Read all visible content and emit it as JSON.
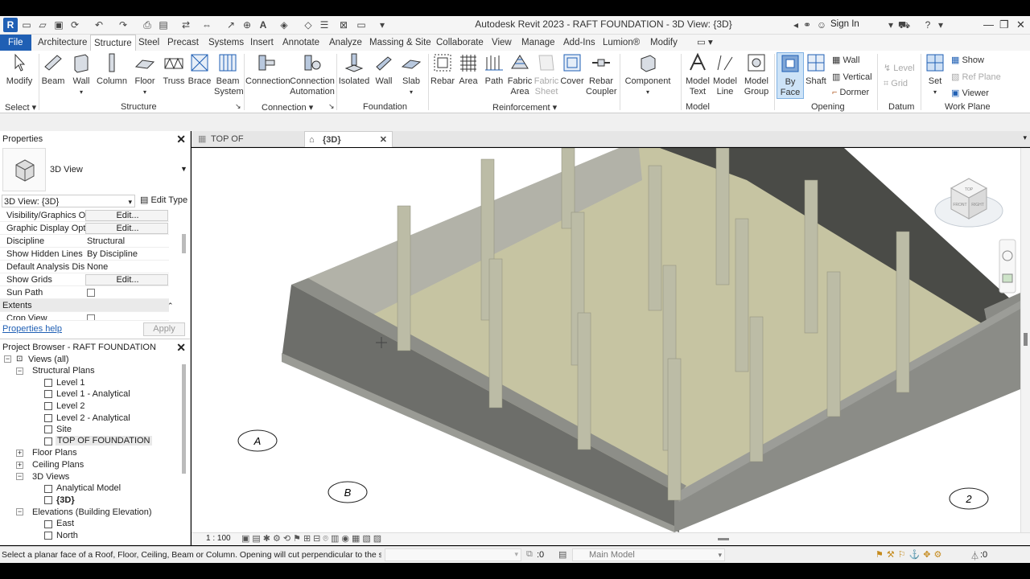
{
  "window": {
    "title": "Autodesk Revit 2023 - RAFT FOUNDATION - 3D View: {3D}",
    "sign_in": "Sign In",
    "app_letter": "R"
  },
  "ribbon_tabs": [
    "File",
    "Architecture",
    "Structure",
    "Steel",
    "Precast",
    "Systems",
    "Insert",
    "Annotate",
    "Analyze",
    "Massing & Site",
    "Collaborate",
    "View",
    "Manage",
    "Add-Ins",
    "Lumion®",
    "Modify"
  ],
  "active_tab": "Structure",
  "ribbon": {
    "tools": [
      {
        "label": "Modify"
      },
      {
        "label": "Beam"
      },
      {
        "label": "Wall"
      },
      {
        "label": "Column"
      },
      {
        "label": "Floor"
      },
      {
        "label": "Truss"
      },
      {
        "label": "Brace"
      },
      {
        "label": "Beam\nSystem"
      },
      {
        "label": "Connection"
      },
      {
        "label": "Connection\nAutomation"
      },
      {
        "label": "Isolated"
      },
      {
        "label": "Wall"
      },
      {
        "label": "Slab"
      },
      {
        "label": "Rebar"
      },
      {
        "label": "Area"
      },
      {
        "label": "Path"
      },
      {
        "label": "Fabric\nArea"
      },
      {
        "label": "Fabric\nSheet"
      },
      {
        "label": "Cover"
      },
      {
        "label": "Rebar\nCoupler"
      },
      {
        "label": "Component"
      },
      {
        "label": "Model\nText"
      },
      {
        "label": "Model\nLine"
      },
      {
        "label": "Model\nGroup"
      },
      {
        "label": "By\nFace"
      },
      {
        "label": "Shaft"
      }
    ],
    "opening_small": [
      "Wall",
      "Vertical",
      "Dormer"
    ],
    "datum_small": [
      "Level",
      "Grid"
    ],
    "workplane_set": "Set",
    "workplane_small": [
      "Show",
      "Ref  Plane",
      "Viewer"
    ],
    "panels": [
      "Select",
      "Structure",
      "Connection",
      "Foundation",
      "Reinforcement",
      "Model",
      "Opening",
      "Datum",
      "Work Plane"
    ]
  },
  "properties": {
    "title": "Properties",
    "type_name": "3D View",
    "selector": "3D View: {3D}",
    "edit_type": "Edit Type",
    "rows": [
      {
        "key": "Visibility/Graphics O...",
        "value": "Edit..."
      },
      {
        "key": "Graphic Display Opt...",
        "value": "Edit..."
      },
      {
        "key": "Discipline",
        "value": "Structural"
      },
      {
        "key": "Show Hidden Lines",
        "value": "By Discipline"
      },
      {
        "key": "Default Analysis Dis...",
        "value": "None"
      },
      {
        "key": "Show Grids",
        "value": "Edit..."
      },
      {
        "key": "Sun Path",
        "value": ""
      }
    ],
    "section": "Extents",
    "crop_view": "Crop View",
    "help": "Properties help",
    "apply": "Apply"
  },
  "browser": {
    "title": "Project Browser - RAFT FOUNDATION",
    "items": [
      {
        "label": "Views (all)"
      },
      {
        "label": "Structural Plans"
      },
      {
        "label": "Level 1"
      },
      {
        "label": "Level 1 - Analytical"
      },
      {
        "label": "Level 2"
      },
      {
        "label": "Level 2 - Analytical"
      },
      {
        "label": "Site"
      },
      {
        "label": "TOP OF FOUNDATION"
      },
      {
        "label": "Floor Plans"
      },
      {
        "label": "Ceiling Plans"
      },
      {
        "label": "3D Views"
      },
      {
        "label": "Analytical Model"
      },
      {
        "label": "{3D}"
      },
      {
        "label": "Elevations (Building Elevation)"
      },
      {
        "label": "East"
      },
      {
        "label": "North"
      }
    ]
  },
  "view_tabs": [
    {
      "label": "TOP OF FOUNDATION"
    },
    {
      "label": "{3D}"
    }
  ],
  "viewport": {
    "grid_bubbles": [
      "A",
      "B",
      "2"
    ],
    "viewcube_top": "TOP",
    "viewcube_front": "FRONT",
    "viewcube_right": "RIGHT"
  },
  "view_control": {
    "scale": "1 : 100"
  },
  "status": {
    "hint": "Select a planar face of a Roof, Floor, Ceiling, Beam or Column. Opening will cut perpendicular to the se",
    "zero1": ":0",
    "model": "Main Model",
    "zero2": ":0"
  },
  "colors": {
    "accent": "#1f5fb4",
    "wall": "#7c7e78",
    "floor": "#c9c7a5",
    "column": "#b9b9a2"
  }
}
